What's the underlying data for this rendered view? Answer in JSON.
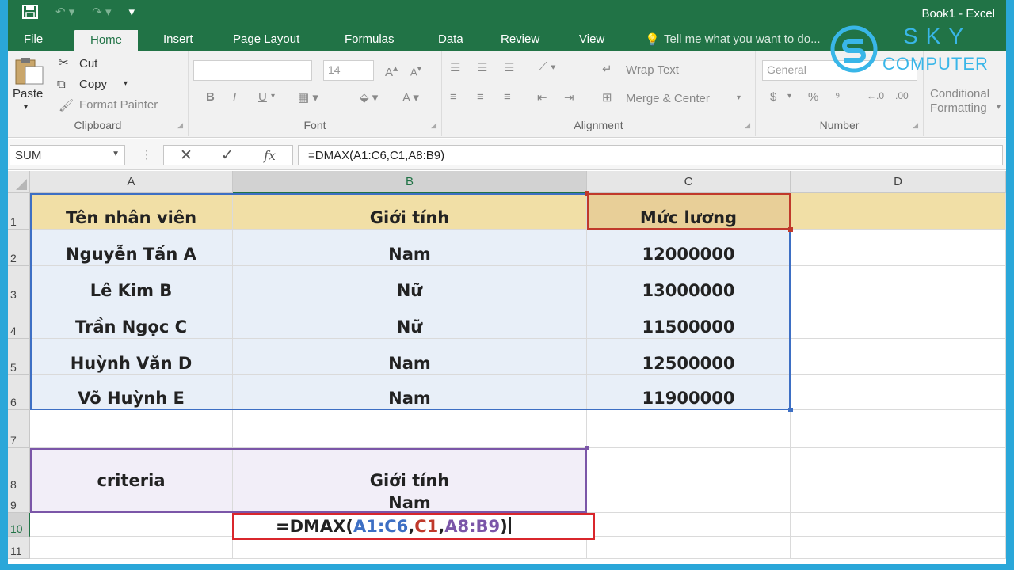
{
  "window": {
    "title": "Book1 - Excel"
  },
  "tabs": [
    {
      "label": "File"
    },
    {
      "label": "Home"
    },
    {
      "label": "Insert"
    },
    {
      "label": "Page Layout"
    },
    {
      "label": "Formulas"
    },
    {
      "label": "Data"
    },
    {
      "label": "Review"
    },
    {
      "label": "View"
    }
  ],
  "tell_me": "Tell me what you want to do...",
  "ribbon": {
    "clipboard": {
      "label": "Clipboard",
      "paste": "Paste",
      "cut": "Cut",
      "copy": "Copy",
      "format_painter": "Format Painter"
    },
    "font": {
      "label": "Font",
      "size": "14",
      "bold": "B",
      "italic": "I",
      "underline": "U"
    },
    "alignment": {
      "label": "Alignment",
      "wrap_text": "Wrap Text",
      "merge_center": "Merge & Center"
    },
    "number": {
      "label": "Number",
      "format": "General",
      "currency": "$",
      "percent": "%",
      "comma": "⁹"
    },
    "styles": {
      "conditional_formatting_1": "Conditional",
      "conditional_formatting_2": "Formatting"
    }
  },
  "formula_bar": {
    "name_box": "SUM",
    "cancel": "✕",
    "enter": "✓",
    "fx": "fx",
    "formula": "=DMAX(A1:C6,C1,A8:B9)"
  },
  "columns": [
    "A",
    "B",
    "C",
    "D"
  ],
  "rows": [
    "1",
    "2",
    "3",
    "4",
    "5",
    "6",
    "7",
    "8",
    "9",
    "10",
    "11"
  ],
  "table": {
    "headers": [
      "Tên nhân viên",
      "Giới tính",
      "Mức lương"
    ],
    "rows": [
      [
        "Nguyễn Tấn A",
        "Nam",
        "12000000"
      ],
      [
        "Lê Kim B",
        "Nữ",
        "13000000"
      ],
      [
        "Trần Ngọc C",
        "Nữ",
        "11500000"
      ],
      [
        "Huỳnh Văn D",
        "Nam",
        "12500000"
      ],
      [
        "Võ Huỳnh E",
        "Nam",
        "11900000"
      ]
    ]
  },
  "criteria": {
    "label": "criteria",
    "field": "Giới tính",
    "value": "Nam"
  },
  "edit_cell": {
    "parts": [
      "=DMAX(",
      "A1:C6",
      ",",
      "C1",
      ",",
      "A8:B9",
      ")"
    ],
    "colors": {
      "ref1": "#3d6fc4",
      "ref2": "#c0392b",
      "ref3": "#7b56a8"
    }
  },
  "logo": {
    "line1": "SKY",
    "line2": "COMPUTER"
  },
  "colors": {
    "excel_green": "#217346",
    "highlight_red": "#d9262c"
  }
}
